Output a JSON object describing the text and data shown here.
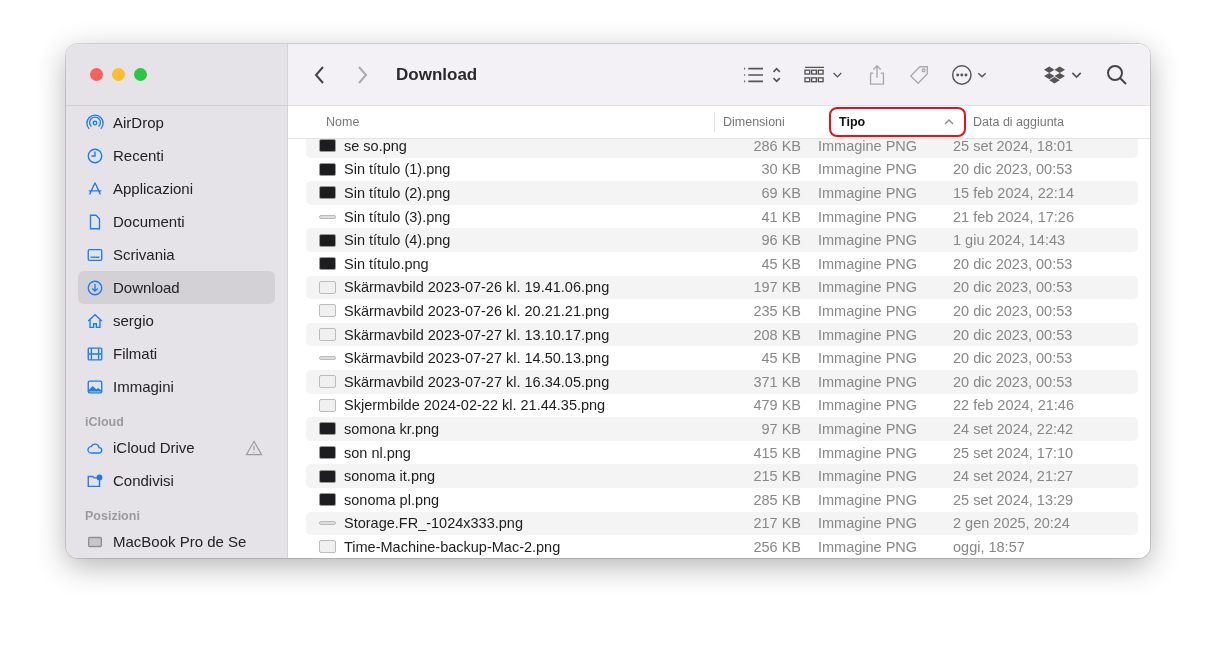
{
  "window": {
    "title": "Download"
  },
  "sidebar": {
    "sections": [
      {
        "items": [
          {
            "label": "AirDrop",
            "kind": "airdrop",
            "selected": false
          },
          {
            "label": "Recenti",
            "kind": "clock",
            "selected": false
          },
          {
            "label": "Applicazioni",
            "kind": "apps",
            "selected": false
          },
          {
            "label": "Documenti",
            "kind": "doc",
            "selected": false
          },
          {
            "label": "Scrivania",
            "kind": "desktop",
            "selected": false
          },
          {
            "label": "Download",
            "kind": "download",
            "selected": true
          },
          {
            "label": "sergio",
            "kind": "home",
            "selected": false
          },
          {
            "label": "Filmati",
            "kind": "film",
            "selected": false
          },
          {
            "label": "Immagini",
            "kind": "photo",
            "selected": false
          }
        ]
      },
      {
        "heading": "iCloud",
        "items": [
          {
            "label": "iCloud Drive",
            "kind": "cloud",
            "selected": false,
            "warning": true
          },
          {
            "label": "Condivisi",
            "kind": "shared",
            "selected": false
          }
        ]
      },
      {
        "heading": "Posizioni",
        "items": [
          {
            "label": "MacBook Pro de Se",
            "kind": "disk",
            "selected": false
          }
        ]
      }
    ]
  },
  "columns": [
    {
      "label": "Nome",
      "sorted": false,
      "highlighted": false
    },
    {
      "label": "Dimensioni",
      "sorted": false,
      "highlighted": false
    },
    {
      "label": "Tipo",
      "sorted": true,
      "highlighted": true
    },
    {
      "label": "Data di aggiunta",
      "sorted": false,
      "highlighted": false
    }
  ],
  "files": [
    {
      "name": "se so.png",
      "size": "286 KB",
      "type": "Immagine PNG",
      "added": "25 set 2024, 18:01",
      "kind": "dark"
    },
    {
      "name": "Sin título (1).png",
      "size": "30 KB",
      "type": "Immagine PNG",
      "added": "20 dic 2023, 00:53",
      "kind": "dark"
    },
    {
      "name": "Sin título (2).png",
      "size": "69 KB",
      "type": "Immagine PNG",
      "added": "15 feb 2024, 22:14",
      "kind": "dark"
    },
    {
      "name": "Sin título (3).png",
      "size": "41 KB",
      "type": "Immagine PNG",
      "added": "21 feb 2024, 17:26",
      "kind": "strip"
    },
    {
      "name": "Sin título (4).png",
      "size": "96 KB",
      "type": "Immagine PNG",
      "added": "1 giu 2024, 14:43",
      "kind": "dark"
    },
    {
      "name": "Sin título.png",
      "size": "45 KB",
      "type": "Immagine PNG",
      "added": "20 dic 2023, 00:53",
      "kind": "dark"
    },
    {
      "name": "Skärmavbild 2023-07-26 kl. 19.41.06.png",
      "size": "197 KB",
      "type": "Immagine PNG",
      "added": "20 dic 2023, 00:53",
      "kind": "light"
    },
    {
      "name": "Skärmavbild 2023-07-26 kl. 20.21.21.png",
      "size": "235 KB",
      "type": "Immagine PNG",
      "added": "20 dic 2023, 00:53",
      "kind": "light"
    },
    {
      "name": "Skärmavbild 2023-07-27 kl. 13.10.17.png",
      "size": "208 KB",
      "type": "Immagine PNG",
      "added": "20 dic 2023, 00:53",
      "kind": "light"
    },
    {
      "name": "Skärmavbild 2023-07-27 kl. 14.50.13.png",
      "size": "45 KB",
      "type": "Immagine PNG",
      "added": "20 dic 2023, 00:53",
      "kind": "strip"
    },
    {
      "name": "Skärmavbild 2023-07-27 kl. 16.34.05.png",
      "size": "371 KB",
      "type": "Immagine PNG",
      "added": "20 dic 2023, 00:53",
      "kind": "light"
    },
    {
      "name": "Skjermbilde 2024-02-22 kl. 21.44.35.png",
      "size": "479 KB",
      "type": "Immagine PNG",
      "added": "22 feb 2024, 21:46",
      "kind": "light"
    },
    {
      "name": "somona kr.png",
      "size": "97 KB",
      "type": "Immagine PNG",
      "added": "24 set 2024, 22:42",
      "kind": "dark"
    },
    {
      "name": "son nl.png",
      "size": "415 KB",
      "type": "Immagine PNG",
      "added": "25 set 2024, 17:10",
      "kind": "dark"
    },
    {
      "name": "sonoma it.png",
      "size": "215 KB",
      "type": "Immagine PNG",
      "added": "24 set 2024, 21:27",
      "kind": "dark"
    },
    {
      "name": "sonoma pl.png",
      "size": "285 KB",
      "type": "Immagine PNG",
      "added": "25 set 2024, 13:29",
      "kind": "dark"
    },
    {
      "name": "Storage.FR_-1024x333.png",
      "size": "217 KB",
      "type": "Immagine PNG",
      "added": "2 gen 2025, 20:24",
      "kind": "strip"
    },
    {
      "name": "Time-Machine-backup-Mac-2.png",
      "size": "256 KB",
      "type": "Immagine PNG",
      "added": "oggi, 18:57",
      "kind": "light"
    }
  ]
}
